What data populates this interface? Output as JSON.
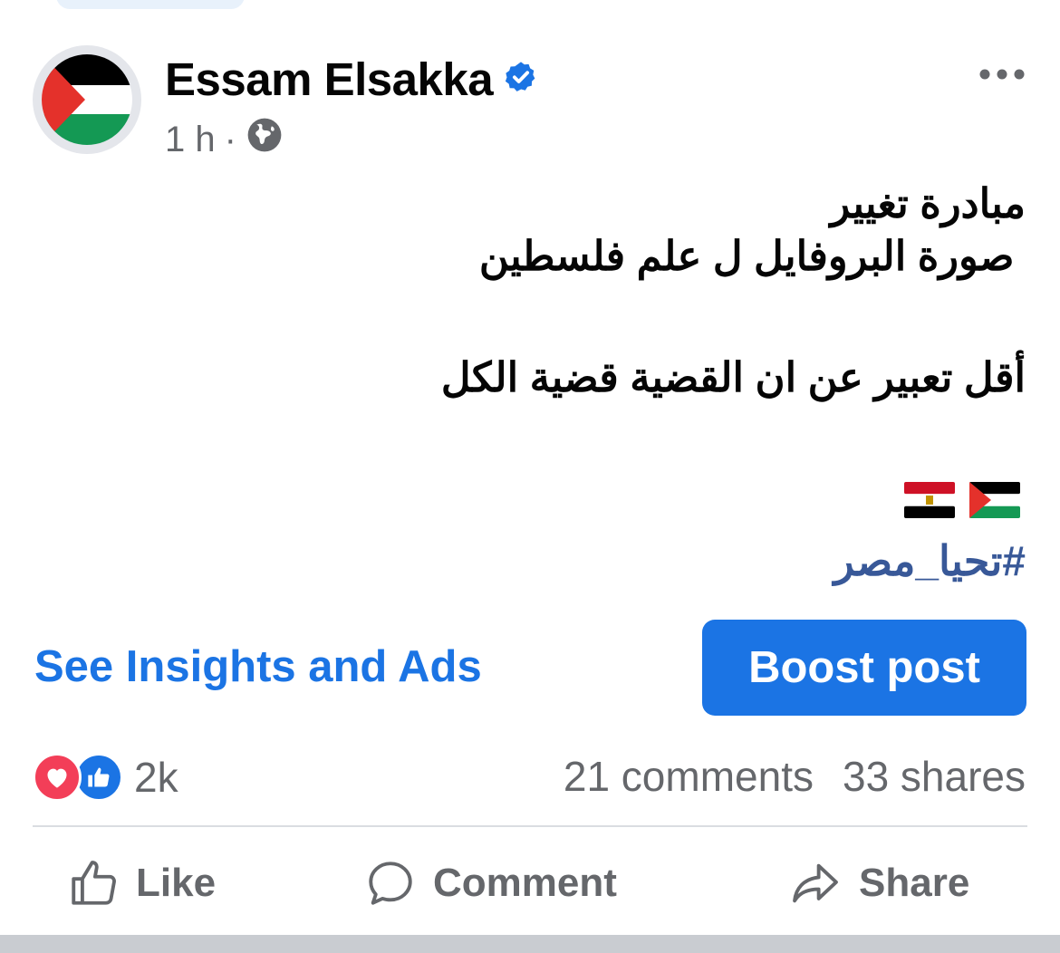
{
  "post": {
    "author": "Essam Elsakka",
    "verified_icon": "verified-badge-icon",
    "timestamp": "1 h",
    "separator": "·",
    "audience_icon": "globe-icon",
    "more_icon": "more-options-icon",
    "text_lines": [
      "مبادرة تغيير",
      " صورة البروفايل ل علم فلسطين  ",
      "أقل تعبير عن ان القضية قضية الكل"
    ],
    "flags": [
      "palestine-flag",
      "egypt-flag"
    ],
    "hashtag": "#تحيا_مصر"
  },
  "promo": {
    "insights_label": "See Insights and Ads",
    "boost_label": "Boost post"
  },
  "engagement": {
    "reaction_icons": [
      "love-reaction-icon",
      "like-reaction-icon"
    ],
    "reaction_count": "2k",
    "comments": "21 comments",
    "shares": "33 shares"
  },
  "actions": {
    "like_label": "Like",
    "comment_label": "Comment",
    "share_label": "Share"
  },
  "colors": {
    "accent": "#1b74e4",
    "hashtag": "#385898",
    "secondary_text": "#65676b",
    "love": "#f33e58"
  }
}
